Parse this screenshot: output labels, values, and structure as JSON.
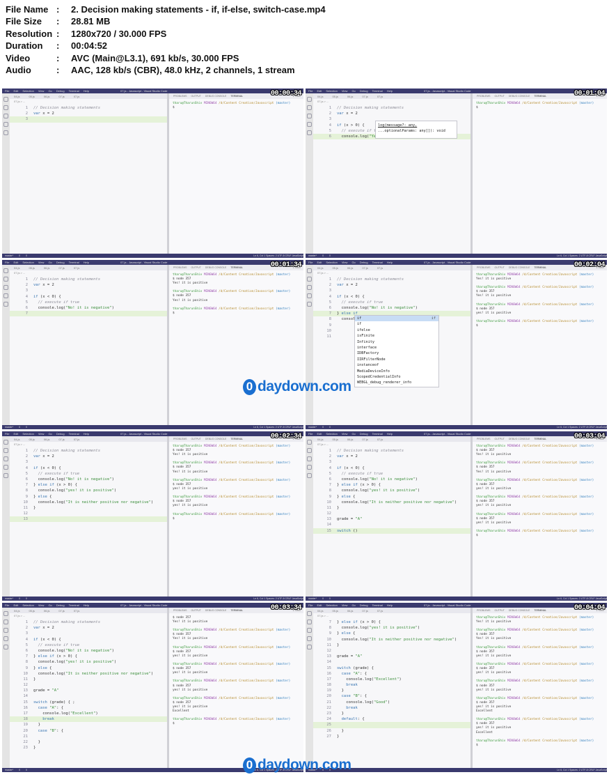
{
  "header": {
    "rows": [
      {
        "key": "File Name",
        "sep": ":",
        "value": "2. Decision making statements - if, if-else, switch-case.mp4"
      },
      {
        "key": "File Size",
        "sep": ":",
        "value": "28.81 MB"
      },
      {
        "key": "Resolution",
        "sep": ":",
        "value": "1280x720 / 30.000 FPS"
      },
      {
        "key": "Duration",
        "sep": ":",
        "value": "00:04:52"
      },
      {
        "key": "Video",
        "sep": ":",
        "value": "AVC (Main@L3.1), 691 kb/s, 30.000 FPS"
      },
      {
        "key": "Audio",
        "sep": ":",
        "value": "AAC, 128 kb/s (CBR), 48.0 kHz, 2 channels, 1 stream"
      }
    ]
  },
  "ui": {
    "menu": [
      "File",
      "Edit",
      "Selection",
      "View",
      "Go",
      "Debug",
      "Terminal",
      "Help"
    ],
    "window_title": "07.js - Javascript - Visual Studio Code",
    "tabs": [
      "04.js",
      "05.js",
      "06.js",
      "07.js",
      "07.js"
    ],
    "breadcrumb": "07.js > ...",
    "panel_tabs": [
      "PROBLEMS",
      "OUTPUT",
      "DEBUG CONSOLE",
      "TERMINAL"
    ],
    "panel_terminal": "1: bash",
    "status_left": [
      "master*",
      "0",
      "0"
    ],
    "status_right": "Ln 6, Col 1   Spaces: 2   UTF-8   CRLF   JavaScript"
  },
  "watermark": {
    "mark": "0",
    "text": "daydown.com"
  },
  "term": {
    "user": "tharu@TharunShiv",
    "mingw": "MINGW64",
    "path": "/d/Content Creation/Javascript",
    "branch": "(master)",
    "prompt": "$",
    "cmd": "$ node 357",
    "out_yes": "Yes! it is positive",
    "out_yes2": "yes! it is positive",
    "out_exc": "Excellent"
  },
  "frames": [
    {
      "timecode": "00:00:34",
      "code": [
        "// Decision making statements",
        "var x = 2",
        ""
      ],
      "hl": 3,
      "term": [
        "P",
        "$"
      ]
    },
    {
      "timecode": "00:01:04",
      "code": [
        "// Decision making statements",
        "var x = 2",
        "",
        "if (x > 0) {",
        "  // execute if tr",
        "  console.log(\"Yes\")"
      ],
      "hl": 6,
      "term": [
        "P",
        "$"
      ],
      "tooltip": [
        "log(message?: any,",
        "...optionalParams: any[]): void"
      ]
    },
    {
      "timecode": "00:01:34",
      "code": [
        "// Decision making statements",
        "var x = 2",
        "",
        "if (x < 0) {",
        "  // execute if true",
        "  console.log(\"No! it is negative\")",
        ""
      ],
      "hl": 7,
      "term": [
        "P",
        "$ node 357",
        "Yes! it is positive",
        "",
        "P",
        "$ node 357",
        "Yes! it is positive",
        "",
        "P",
        "$"
      ]
    },
    {
      "timecode": "00:02:04",
      "code": [
        "// Decision making statements",
        "var x = 2",
        "",
        "if (x < 0) {",
        "  // execute if true",
        "  console.log(\"No! it is negative\")",
        "} else if",
        "  console",
        "",
        "",
        ""
      ],
      "hl": 7,
      "term": [
        "P",
        "Yes! it is positive",
        "",
        "P",
        "$ node 357",
        "Yes! it is positive",
        "",
        "P",
        "$ node 357",
        "yes! it is positive",
        "",
        "P",
        "$"
      ],
      "suggest": [
        "if",
        "if",
        "ifelse",
        "isFinite",
        "Infinity",
        "interface",
        "IDBFactory",
        "IIRFilterNode",
        "instanceof",
        "MediaDeviceInfo",
        "ScopedCredentialInfo",
        "WEBGL_debug_renderer_info"
      ]
    },
    {
      "timecode": "00:02:34",
      "code": [
        "// Decision making statements",
        "var x = 2",
        "",
        "if (x < 0) {",
        "  // execute if true",
        "  console.log(\"No! it is negative\")",
        "} else if (x > 0) {",
        "  console.log(\"yes! it is positive\")",
        "} else {",
        "  console.log(\"It is neither positive nor negative\")",
        "}",
        "",
        ""
      ],
      "hl": 13,
      "term": [
        "P",
        "$ node 357",
        "Yes! it is positive",
        "",
        "P",
        "$ node 357",
        "Yes! it is positive",
        "",
        "P",
        "$ node 357",
        "yes! it is positive",
        "",
        "P",
        "$ node 357",
        "yes! it is positive",
        "",
        "P",
        "$"
      ]
    },
    {
      "timecode": "00:03:04",
      "code": [
        "// Decision making statements",
        "var x = 2",
        "",
        "if (x < 0) {",
        "  // execute if true",
        "  console.log(\"No! it is negative\")",
        "} else if (x > 0) {",
        "  console.log(\"yes! it is positive\")",
        "} else {",
        "  console.log(\"It is neither positive nor negative\")",
        "}",
        "",
        "grade = \"A\"",
        "",
        "switch ()"
      ],
      "hl": 15,
      "term": [
        "P",
        "$ node 357",
        "Yes! it is positive",
        "",
        "P",
        "$ node 357",
        "Yes! it is positive",
        "",
        "P",
        "$ node 357",
        "yes! it is positive",
        "",
        "P",
        "$ node 357",
        "yes! it is positive",
        "",
        "P",
        "$ node 357",
        "yes! it is positive",
        "",
        "P",
        "$"
      ]
    },
    {
      "timecode": "00:03:34",
      "code": [
        "// Decision making statements",
        "var x = 2",
        "",
        "if (x < 0) {",
        "  // execute if true",
        "  console.log(\"No! it is negative\")",
        "} else if (x > 0) {",
        "  console.log(\"yes! it is positive\")",
        "} else {",
        "  console.log(\"It is neither positive nor negative\")",
        "}",
        "",
        "grade = \"A\"",
        "",
        "switch (grade) { ;",
        "  case \"A\": {",
        "    console.log(\"Excellent\")",
        "    break",
        "  }",
        "  case \"B\": {",
        "",
        "  }",
        "}"
      ],
      "hl": 18,
      "term": [
        "$ node 357",
        "Yes! it is positive",
        "",
        "P",
        "$ node 357",
        "Yes! it is positive",
        "",
        "P",
        "$ node 357",
        "yes! it is positive",
        "",
        "P",
        "$ node 357",
        "yes! it is positive",
        "",
        "P",
        "$ node 357",
        "yes! it is positive",
        "",
        "P",
        "$ node 357",
        "yes! it is positive",
        "Excellent",
        "",
        "P",
        "$"
      ]
    },
    {
      "timecode": "00:04:04",
      "code": [
        "} else if (x > 0) {",
        "  console.log(\"yes! it is positive\")",
        "} else {",
        "  console.log(\"It is neither positive nor negative\")",
        "}",
        "",
        "grade = \"A\"",
        "",
        "switch (grade) {",
        "  case \"A\": {",
        "    console.log(\"Excellent\")",
        "    break",
        "  }",
        "  case \"B\": {",
        "    console.log(\"Good\")",
        "    break",
        "  }",
        "  default: {",
        "",
        "  }",
        "}"
      ],
      "start": 7,
      "hl": 25,
      "term": [
        "P",
        "Yes! it is positive",
        "",
        "P",
        "$ node 357",
        "Yes! it is positive",
        "",
        "P",
        "$ node 357",
        "yes! it is positive",
        "",
        "P",
        "$ node 357",
        "yes! it is positive",
        "",
        "P",
        "$ node 357",
        "yes! it is positive",
        "",
        "P",
        "$ node 357",
        "yes! it is positive",
        "Excellent",
        "",
        "P",
        "$ node 357",
        "yes! it is positive",
        "Excellent",
        "",
        "P",
        "$"
      ]
    }
  ]
}
